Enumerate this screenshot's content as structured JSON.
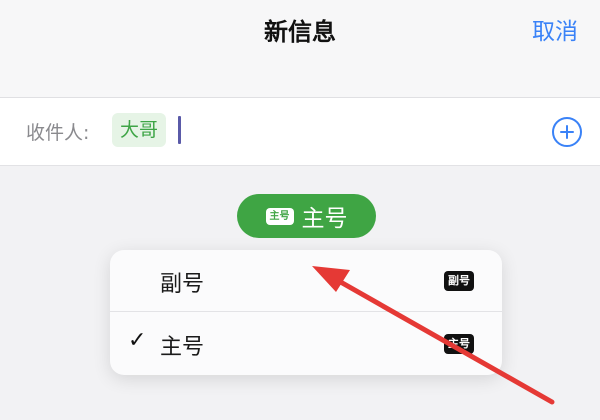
{
  "header": {
    "title": "新信息",
    "cancel_label": "取消"
  },
  "recipient": {
    "label": "收件人:",
    "contact": "大哥"
  },
  "line_selector": {
    "badge": "主号",
    "selected": "主号"
  },
  "menu": {
    "items": [
      {
        "label": "副号",
        "badge": "副号",
        "checked": false
      },
      {
        "label": "主号",
        "badge": "主号",
        "checked": true
      }
    ],
    "check_glyph": "✓"
  },
  "icons": {
    "add": "plus-circle-icon",
    "check": "checkmark-icon"
  },
  "colors": {
    "accent_blue": "#3a82f7",
    "pill_green": "#3fa544",
    "chip_green_text": "#3ea546",
    "annotation_red": "#e53935"
  }
}
